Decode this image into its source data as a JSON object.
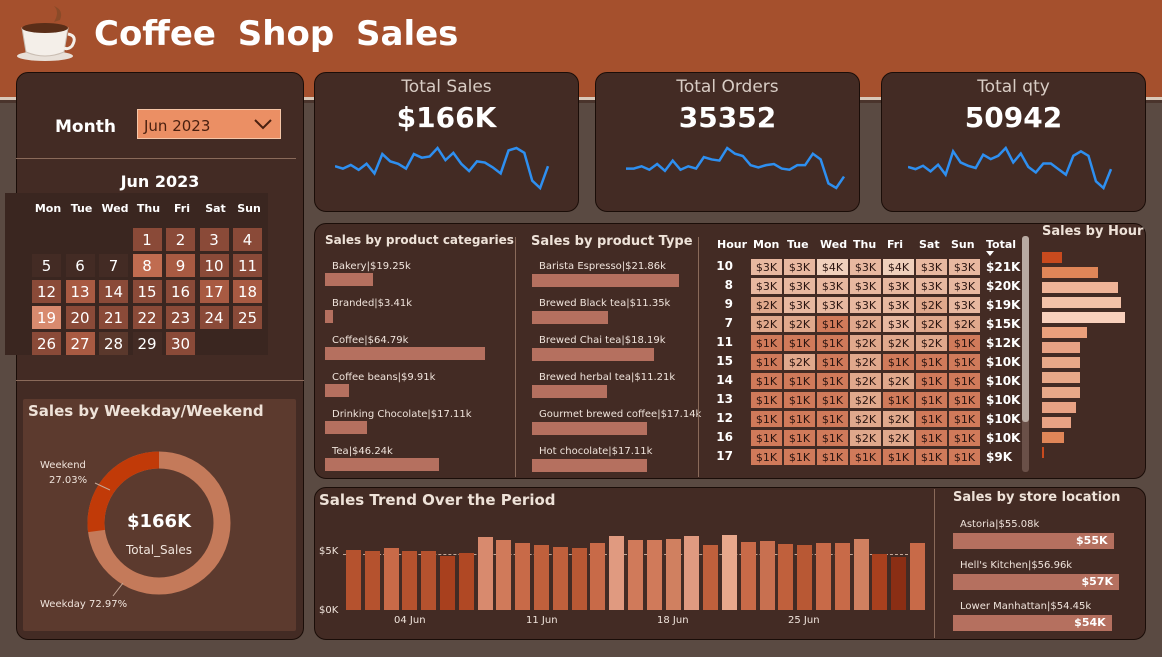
{
  "header": {
    "title": "Coffee  Shop  Sales",
    "logo_icon": "coffee-cup-icon"
  },
  "filters": {
    "month_label": "Month",
    "month_value": "Jun 2023"
  },
  "calendar": {
    "title": "Jun 2023",
    "days_of_week": [
      "Mon",
      "Tue",
      "Wed",
      "Thu",
      "Fri",
      "Sat",
      "Sun"
    ],
    "days": [
      "1",
      "2",
      "3",
      "4",
      "5",
      "6",
      "7",
      "8",
      "9",
      "10",
      "11",
      "12",
      "13",
      "14",
      "15",
      "16",
      "17",
      "18",
      "19",
      "20",
      "21",
      "22",
      "23",
      "24",
      "25",
      "26",
      "27",
      "28",
      "29",
      "30"
    ]
  },
  "kpis": [
    {
      "title": "Total Sales",
      "value": "$166K"
    },
    {
      "title": "Total Orders",
      "value": "35352"
    },
    {
      "title": "Total qty",
      "value": "50942"
    }
  ],
  "weekday": {
    "title": "Sales by Weekday/Weekend",
    "center_value": "$166K",
    "center_label": "Total_Sales",
    "weekend_label": "Weekend",
    "weekend_pct": "27.03%",
    "weekday_label": "Weekday 72.97%",
    "weekend_fraction": 0.2703
  },
  "categories": {
    "title": "Sales by product categaries",
    "items": [
      {
        "label": "Bakery|$19.25k",
        "value": 19.25
      },
      {
        "label": "Branded|$3.41k",
        "value": 3.41
      },
      {
        "label": "Coffee|$64.79k",
        "value": 64.79
      },
      {
        "label": "Coffee beans|$9.91k",
        "value": 9.91
      },
      {
        "label": "Drinking Chocolate|$17.11k",
        "value": 17.11
      },
      {
        "label": "Tea|$46.24k",
        "value": 46.24
      }
    ]
  },
  "product_types": {
    "title": "Sales by product Type",
    "items": [
      {
        "label": "Barista Espresso|$21.86k",
        "value": 21.86
      },
      {
        "label": "Brewed Black tea|$11.35k",
        "value": 11.35
      },
      {
        "label": "Brewed Chai tea|$18.19k",
        "value": 18.19
      },
      {
        "label": "Brewed herbal tea|$11.21k",
        "value": 11.21
      },
      {
        "label": "Gourmet brewed coffee|$17.14k",
        "value": 17.14
      },
      {
        "label": "Hot chocolate|$17.11k",
        "value": 17.11
      }
    ]
  },
  "heatmap": {
    "headers": [
      "Hour",
      "Mon",
      "Tue",
      "Wed",
      "Thu",
      "Fri",
      "Sat",
      "Sun",
      "Total"
    ],
    "rows": [
      {
        "hour": "10",
        "cells": [
          "$3K",
          "$3K",
          "$4K",
          "$3K",
          "$4K",
          "$3K",
          "$3K"
        ],
        "total": "$21K"
      },
      {
        "hour": "8",
        "cells": [
          "$3K",
          "$3K",
          "$3K",
          "$3K",
          "$3K",
          "$3K",
          "$3K"
        ],
        "total": "$20K"
      },
      {
        "hour": "9",
        "cells": [
          "$2K",
          "$3K",
          "$3K",
          "$3K",
          "$3K",
          "$2K",
          "$3K"
        ],
        "total": "$19K"
      },
      {
        "hour": "7",
        "cells": [
          "$2K",
          "$2K",
          "$1K",
          "$2K",
          "$3K",
          "$2K",
          "$2K"
        ],
        "total": "$15K"
      },
      {
        "hour": "11",
        "cells": [
          "$1K",
          "$1K",
          "$1K",
          "$2K",
          "$2K",
          "$2K",
          "$1K"
        ],
        "total": "$12K"
      },
      {
        "hour": "15",
        "cells": [
          "$1K",
          "$2K",
          "$1K",
          "$2K",
          "$1K",
          "$1K",
          "$1K"
        ],
        "total": "$10K"
      },
      {
        "hour": "14",
        "cells": [
          "$1K",
          "$1K",
          "$1K",
          "$2K",
          "$2K",
          "$1K",
          "$1K"
        ],
        "total": "$10K"
      },
      {
        "hour": "13",
        "cells": [
          "$1K",
          "$1K",
          "$1K",
          "$2K",
          "$1K",
          "$1K",
          "$1K"
        ],
        "total": "$10K"
      },
      {
        "hour": "12",
        "cells": [
          "$1K",
          "$1K",
          "$1K",
          "$2K",
          "$2K",
          "$1K",
          "$1K"
        ],
        "total": "$10K"
      },
      {
        "hour": "16",
        "cells": [
          "$1K",
          "$1K",
          "$1K",
          "$2K",
          "$2K",
          "$1K",
          "$1K"
        ],
        "total": "$10K"
      },
      {
        "hour": "17",
        "cells": [
          "$1K",
          "$1K",
          "$1K",
          "$1K",
          "$1K",
          "$1K",
          "$1K"
        ],
        "total": "$9K"
      }
    ],
    "shades": [
      [
        "#e8b8a0",
        "#e8b8a0",
        "#f0d0bc",
        "#e8b8a0",
        "#f0d0bc",
        "#e8b8a0",
        "#e8b8a0"
      ],
      [
        "#e8b8a0",
        "#e8b8a0",
        "#e8b8a0",
        "#e8b8a0",
        "#e8b8a0",
        "#e8b8a0",
        "#e8b8a0"
      ],
      [
        "#e0a88c",
        "#e8b8a0",
        "#e8b8a0",
        "#e8b8a0",
        "#e8b8a0",
        "#e0a88c",
        "#e8b8a0"
      ],
      [
        "#e0a88c",
        "#e0a88c",
        "#d07a5a",
        "#e0a88c",
        "#e8b8a0",
        "#e0a88c",
        "#e0a88c"
      ],
      [
        "#d07a5a",
        "#d07a5a",
        "#d07a5a",
        "#e0a88c",
        "#e0a88c",
        "#e0a88c",
        "#d07a5a"
      ],
      [
        "#d07a5a",
        "#e0a88c",
        "#d07a5a",
        "#e0a88c",
        "#d07a5a",
        "#d07a5a",
        "#d07a5a"
      ],
      [
        "#d07a5a",
        "#d07a5a",
        "#d07a5a",
        "#e0a88c",
        "#e0a88c",
        "#d07a5a",
        "#d07a5a"
      ],
      [
        "#d07a5a",
        "#d07a5a",
        "#d07a5a",
        "#e0a88c",
        "#d07a5a",
        "#d07a5a",
        "#d07a5a"
      ],
      [
        "#d07a5a",
        "#d07a5a",
        "#d07a5a",
        "#e0a88c",
        "#e0a88c",
        "#d07a5a",
        "#d07a5a"
      ],
      [
        "#d07a5a",
        "#d07a5a",
        "#d07a5a",
        "#e0a88c",
        "#e0a88c",
        "#d07a5a",
        "#d07a5a"
      ],
      [
        "#d07a5a",
        "#d07a5a",
        "#d07a5a",
        "#d07a5a",
        "#d07a5a",
        "#d07a5a",
        "#d07a5a"
      ]
    ]
  },
  "sales_by_hour": {
    "title": "Sales by Hour",
    "values": [
      9,
      25,
      34,
      35,
      37,
      20,
      17,
      17,
      17,
      17,
      15,
      13,
      10,
      1
    ],
    "colors": [
      "#c84a1e",
      "#e08658",
      "#f0b498",
      "#f3c2a8",
      "#f8d0bc",
      "#eba07c",
      "#e8a284",
      "#e8a888",
      "#e8a888",
      "#e8a888",
      "#e8a284",
      "#e8a284",
      "#e08658",
      "#c84a1e"
    ]
  },
  "trend": {
    "title": "Sales Trend Over the Period",
    "y_ticks": [
      "$5K",
      "$0K"
    ],
    "x_ticks": [
      "04 Jun",
      "11 Jun",
      "18 Jun",
      "25 Jun"
    ],
    "values": [
      5.3,
      5.2,
      5.5,
      5.2,
      5.2,
      4.8,
      5.0,
      6.4,
      6.2,
      5.9,
      5.7,
      5.6,
      5.5,
      5.9,
      6.5,
      6.2,
      6.2,
      6.3,
      6.5,
      5.7,
      6.6,
      6.0,
      6.1,
      5.8,
      5.7,
      5.9,
      5.9,
      6.3,
      4.9,
      4.7,
      5.9
    ],
    "colors": [
      "#b5522e",
      "#b5522e",
      "#c86a48",
      "#b5522e",
      "#b5522e",
      "#a8401e",
      "#b04824",
      "#d88a6e",
      "#d07a5a",
      "#c86a48",
      "#c0603c",
      "#c0603c",
      "#b85834",
      "#c86a48",
      "#e09a80",
      "#d07a5a",
      "#d07a5a",
      "#d08060",
      "#e09a80",
      "#c0603c",
      "#e8a88c",
      "#c86a48",
      "#c87050",
      "#c0603c",
      "#b85834",
      "#c86a48",
      "#c86a48",
      "#d08060",
      "#a8401e",
      "#8a2e14",
      "#c86a48"
    ],
    "y_max": 7.5
  },
  "stores": {
    "title": "Sales by store location",
    "items": [
      {
        "label": "Astoria|$55.08k",
        "value_label": "$55K",
        "value": 55.08
      },
      {
        "label": "Hell's Kitchen|$56.96k",
        "value_label": "$57K",
        "value": 56.96
      },
      {
        "label": "Lower Manhattan|$54.45k",
        "value_label": "$54K",
        "value": 54.45
      }
    ]
  },
  "sparklines": {
    "sales": [
      60,
      62,
      59,
      63,
      58,
      66,
      50,
      56,
      58,
      62,
      50,
      53,
      52,
      45,
      55,
      49,
      58,
      64,
      56,
      57,
      61,
      66,
      47,
      45,
      49,
      72,
      78,
      60
    ],
    "orders": [
      63,
      63,
      61,
      64,
      59,
      65,
      56,
      64,
      61,
      63,
      53,
      55,
      56,
      45,
      50,
      52,
      60,
      62,
      60,
      59,
      63,
      64,
      60,
      60,
      50,
      55,
      76,
      80,
      70
    ],
    "qty": [
      60,
      62,
      59,
      64,
      58,
      67,
      46,
      56,
      59,
      61,
      49,
      53,
      50,
      43,
      56,
      48,
      60,
      65,
      57,
      57,
      62,
      67,
      50,
      46,
      50,
      73,
      79,
      62
    ]
  },
  "colors": {
    "header": "#a5502d",
    "panel": "#432b24",
    "accent_line": "#2e8ff0",
    "bar": "#b5705f"
  }
}
